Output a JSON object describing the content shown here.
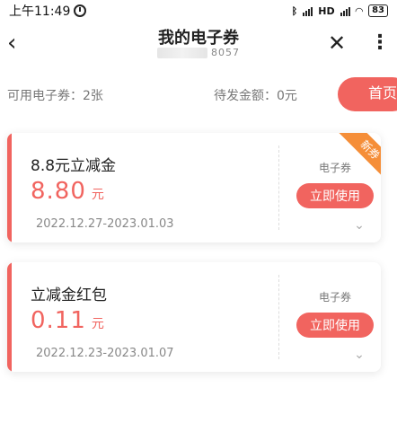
{
  "status_bar": {
    "time": "上午11:49",
    "network": "HD",
    "battery": "83"
  },
  "nav": {
    "title": "我的电子券",
    "subtitle": "8057"
  },
  "summary": {
    "available": "可用电子券：2张",
    "pending": "待发金额：0元",
    "home_button": "首页"
  },
  "coupons": [
    {
      "name": "8.8元立减金",
      "amount": "8.80",
      "unit": "元",
      "dates": "2022.12.27-2023.01.03",
      "type": "电子券",
      "action": "立即使用",
      "badge": "新券"
    },
    {
      "name": "立减金红包",
      "amount": "0.11",
      "unit": "元",
      "dates": "2022.12.23-2023.01.07",
      "type": "电子券",
      "action": "立即使用"
    }
  ],
  "colors": {
    "accent": "#f1645f",
    "badge": "#f58e38"
  }
}
